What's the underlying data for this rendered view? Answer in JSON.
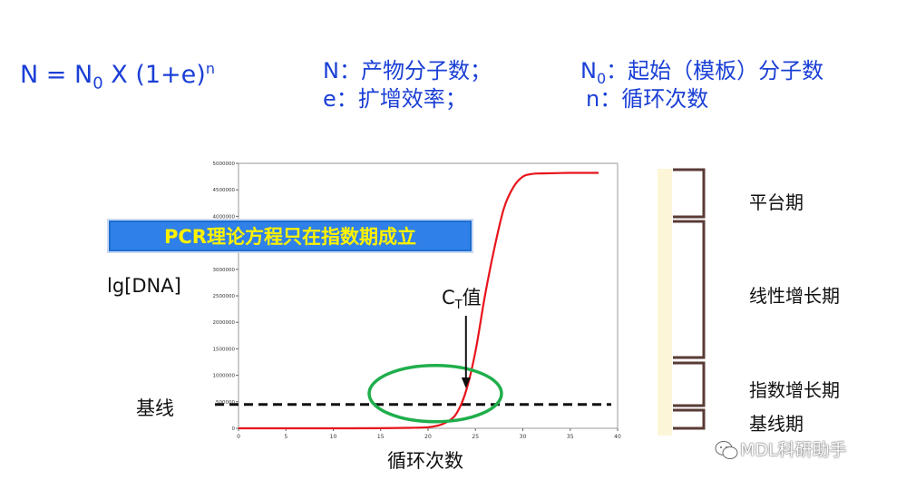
{
  "formula": {
    "n": "N",
    "eq": " = ",
    "n0_base": "N",
    "n0_sub": "0",
    "rest": " X (1+e)",
    "exp": "n"
  },
  "definitions": {
    "line1": "N：产物分子数；",
    "line2": "e：扩增效率；",
    "line3_base": "N",
    "line3_sub": "0",
    "line3_rest": "：起始（模板）分子数",
    "line4": "n：循环次数"
  },
  "banner": "PCR理论方程只在指数期成立",
  "labels": {
    "y_axis": "lg[DNA]",
    "baseline": "基线",
    "x_axis": "循环次数",
    "ct_base": "C",
    "ct_sub": "T",
    "ct_rest": "值"
  },
  "phases": {
    "plateau": "平台期",
    "linear": "线性增长期",
    "exponential": "指数增长期",
    "baseline": "基线期"
  },
  "watermark": "MDL科研助手",
  "colors": {
    "text_blue": "#1a3fd6",
    "curve": "#e8131b",
    "ellipse": "#1fae4b",
    "banner_bg": "#2f80e8",
    "banner_text": "#fff200",
    "bracket": "#5a3b36"
  },
  "chart_data": {
    "type": "line",
    "x_ticks": [
      "0",
      "5",
      "10",
      "15",
      "20",
      "25",
      "30",
      "35",
      "40"
    ],
    "y_ticks": [
      "0",
      "500000",
      "1000000",
      "1500000",
      "2000000",
      "2500000",
      "3000000",
      "3500000",
      "4000000",
      "4500000",
      "5000000"
    ],
    "xlim": [
      0,
      40
    ],
    "ylim": [
      0,
      5000000
    ],
    "grid": false,
    "series": [
      {
        "x": [
          0,
          5,
          10,
          15,
          18,
          20,
          21,
          22,
          23,
          24,
          25,
          26,
          27,
          28,
          29,
          30,
          31,
          32,
          35,
          38
        ],
        "y": [
          0,
          0,
          0,
          2000,
          8000,
          20000,
          50000,
          120000,
          280000,
          700000,
          1450000,
          2500000,
          3400000,
          4150000,
          4550000,
          4750000,
          4800000,
          4810000,
          4820000,
          4820000
        ]
      }
    ],
    "baseline_value": 450000,
    "ct_cycle": 24
  }
}
